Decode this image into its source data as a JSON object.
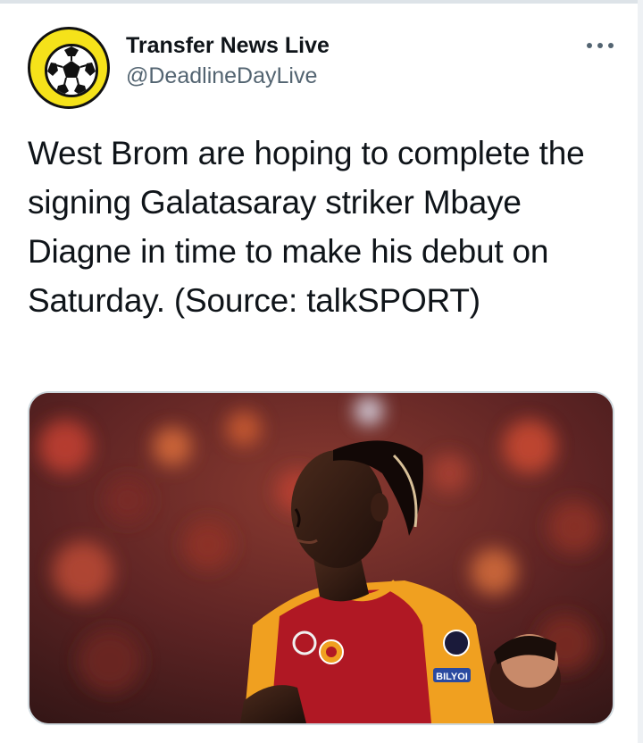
{
  "tweet": {
    "display_name": "Transfer News Live",
    "handle": "@DeadlineDayLive",
    "text": "West Brom are hoping to complete the signing Galatasaray striker Mbaye Diagne in time to make his debut on Saturday. (Source: talkSPORT)",
    "avatar_icon": "soccer-ball-icon",
    "more_icon": "more-options-icon",
    "media": {
      "kit_sponsor": "BILYOI"
    }
  },
  "colors": {
    "avatar_bg": "#f5e21a",
    "text_primary": "#0f1419",
    "text_secondary": "#536471",
    "kit_orange": "#f0a020",
    "kit_red": "#b01824"
  }
}
